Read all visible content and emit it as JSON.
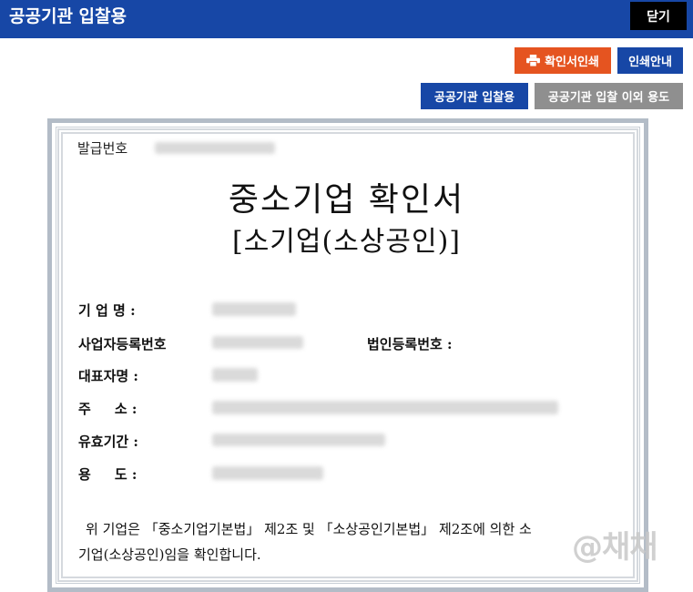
{
  "header": {
    "title": "공공기관 입찰용",
    "close_label": "닫기",
    "bg_color": "#1747a6"
  },
  "toolbar": {
    "print_label": "확인서인쇄",
    "print_icon": "printer-icon",
    "guide_label": "인쇄안내",
    "public_label": "공공기관 입찰용",
    "other_label": "공공기관 입찰 이외 용도",
    "print_color": "#e55420",
    "other_color": "#8f8f8f"
  },
  "certificate": {
    "issue_number_label": "발급번호",
    "title": "중소기업 확인서",
    "subtitle": "[소기업(소상공인)]",
    "fields": {
      "company_name_label": "기 업 명 :",
      "business_reg_label": "사업자등록번호",
      "corporate_reg_label": "법인등록번호 :",
      "representative_label": "대표자명 :",
      "address_label": "주     소 :",
      "validity_label": "유효기간 :",
      "purpose_label": "용     도 :"
    },
    "statement_line1": "위 기업은 「중소기업기본법」 제2조 및 「소상공인기본법」 제2조에 의한 소",
    "statement_line2": "기업(소상공인)임을 확인합니다."
  },
  "watermark": "@채채"
}
